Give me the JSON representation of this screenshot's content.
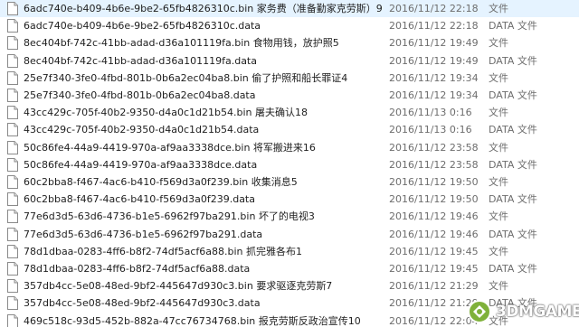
{
  "files": [
    {
      "name": "6adc740e-b409-4b6e-9be2-65fb4826310c.bin 家务费（准备勤家克劳斯）9",
      "date": "2016/11/12 22:18",
      "type": "文件",
      "selected": true
    },
    {
      "name": "6adc740e-b409-4b6e-9be2-65fb4826310c.data",
      "date": "2016/11/12 22:18",
      "type": "DATA 文件",
      "selected": false
    },
    {
      "name": "8ec404bf-742c-41bb-adad-d36a101119fa.bin 食物用钱，放护照5",
      "date": "2016/11/12 19:49",
      "type": "文件",
      "selected": false
    },
    {
      "name": "8ec404bf-742c-41bb-adad-d36a101119fa.data",
      "date": "2016/11/12 19:49",
      "type": "DATA 文件",
      "selected": false
    },
    {
      "name": "25e7f340-3fe0-4fbd-801b-0b6a2ec04ba8.bin 偷了护照和船长罪证4",
      "date": "2016/11/12 19:34",
      "type": "文件",
      "selected": false
    },
    {
      "name": "25e7f340-3fe0-4fbd-801b-0b6a2ec04ba8.data",
      "date": "2016/11/12 19:34",
      "type": "DATA 文件",
      "selected": false
    },
    {
      "name": "43cc429c-705f-40b2-9350-d4a0c1d21b54.bin 屠夫确认18",
      "date": "2016/11/13 0:16",
      "type": "文件",
      "selected": false
    },
    {
      "name": "43cc429c-705f-40b2-9350-d4a0c1d21b54.data",
      "date": "2016/11/13 0:16",
      "type": "DATA 文件",
      "selected": false
    },
    {
      "name": "50c86fe4-44a9-4419-970a-af9aa3338dce.bin 将军搬进来16",
      "date": "2016/11/12 23:58",
      "type": "文件",
      "selected": false
    },
    {
      "name": "50c86fe4-44a9-4419-970a-af9aa3338dce.data",
      "date": "2016/11/12 23:58",
      "type": "DATA 文件",
      "selected": false
    },
    {
      "name": "60c2bba8-f467-4ac6-b410-f569d3a0f239.bin 收集消息5",
      "date": "2016/11/12 19:50",
      "type": "文件",
      "selected": false
    },
    {
      "name": "60c2bba8-f467-4ac6-b410-f569d3a0f239.data",
      "date": "2016/11/12 19:50",
      "type": "DATA 文件",
      "selected": false
    },
    {
      "name": "77e6d3d5-63d6-4736-b1e5-6962f97ba291.bin 坏了的电视3",
      "date": "2016/11/12 19:46",
      "type": "文件",
      "selected": false
    },
    {
      "name": "77e6d3d5-63d6-4736-b1e5-6962f97ba291.data",
      "date": "2016/11/12 19:46",
      "type": "DATA 文件",
      "selected": false
    },
    {
      "name": "78d1dbaa-0283-4ff6-b8f2-74df5acf6a88.bin 抓完雅各布1",
      "date": "2016/11/12 19:45",
      "type": "文件",
      "selected": false
    },
    {
      "name": "78d1dbaa-0283-4ff6-b8f2-74df5acf6a88.data",
      "date": "2016/11/12 19:45",
      "type": "DATA 文件",
      "selected": false
    },
    {
      "name": "357db4cc-5e08-48ed-9bf2-445647d930c3.bin 要求驱逐克劳斯7",
      "date": "2016/11/12 21:29",
      "type": "文件",
      "selected": false
    },
    {
      "name": "357db4cc-5e08-48ed-9bf2-445647d930c3.data",
      "date": "2016/11/12 21:29",
      "type": "DATA 文件",
      "selected": false
    },
    {
      "name": "469c518c-93d5-452b-882a-47cc76734768.bin 报克劳斯反政治宣传10",
      "date": "2016/11/12 22:04",
      "type": "文件",
      "selected": false
    }
  ],
  "watermark": {
    "text": "3DMGAME"
  }
}
